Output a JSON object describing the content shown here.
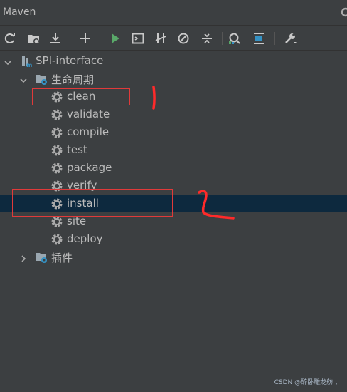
{
  "window": {
    "title": "Maven"
  },
  "toolbar": {
    "buttons": [
      "reload-icon",
      "add-folder-icon",
      "download-icon",
      "plus-icon",
      "run-icon",
      "run-config-icon",
      "toggle-offline-icon",
      "skip-tests-icon",
      "collapse-icon",
      "analyze-icon",
      "expand-icon",
      "settings-wrench-icon"
    ]
  },
  "tree": {
    "project": "SPI-interface",
    "lifecycle_label": "生命周期",
    "lifecycle": [
      "clean",
      "validate",
      "compile",
      "test",
      "package",
      "verify",
      "install",
      "site",
      "deploy"
    ],
    "selected": "install",
    "plugins_label": "插件"
  },
  "annotations": {
    "mark1": "1",
    "mark2": "2"
  },
  "watermark": "CSDN @醉卧雕龙舫 、",
  "colors": {
    "background": "#3c3f41",
    "selection": "#0d293e",
    "annotation": "#e03a3a",
    "run": "#59a869"
  }
}
